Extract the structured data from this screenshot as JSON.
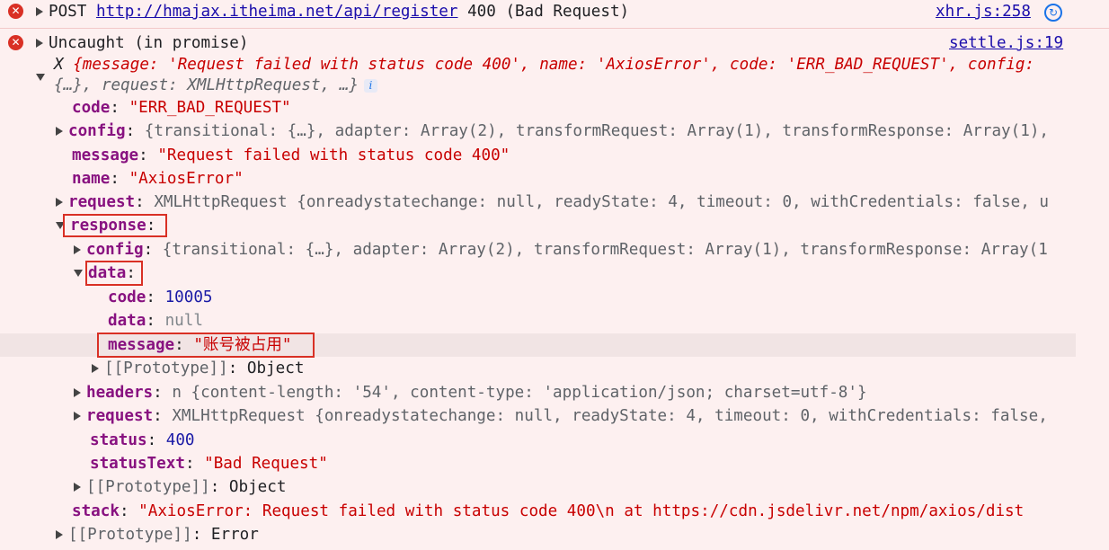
{
  "request_row": {
    "method": "POST",
    "url": "http://hmajax.itheima.net/api/register",
    "status": "400 (Bad Request)",
    "source": "xhr.js:258"
  },
  "error_row": {
    "title": "Uncaught (in promise)",
    "source": "settle.js:19"
  },
  "summary": {
    "prefix": "X ",
    "line1": "{message: 'Request failed with status code 400', name: 'AxiosError', code: 'ERR_BAD_REQUEST', config:",
    "line2": "{…}, request: XMLHttpRequest, …}",
    "info": "i"
  },
  "props": {
    "code": {
      "key": "code",
      "value": "\"ERR_BAD_REQUEST\""
    },
    "config": {
      "key": "config",
      "value": "{transitional: {…}, adapter: Array(2), transformRequest: Array(1), transformResponse: Array(1),"
    },
    "message": {
      "key": "message",
      "value": "\"Request failed with status code 400\""
    },
    "name": {
      "key": "name",
      "value": "\"AxiosError\""
    },
    "request": {
      "key": "request",
      "value": "XMLHttpRequest {onreadystatechange: null, readyState: 4, timeout: 0, withCredentials: false, u"
    },
    "response": {
      "key": "response"
    },
    "stack": {
      "key": "stack",
      "value": "\"AxiosError: Request failed with status code 400\\n    at https://cdn.jsdelivr.net/npm/axios/dist"
    },
    "proto": {
      "key": "[[Prototype]]",
      "value": "Error"
    }
  },
  "response": {
    "config": {
      "key": "config",
      "value": "{transitional: {…}, adapter: Array(2), transformRequest: Array(1), transformResponse: Array(1"
    },
    "data": {
      "key": "data"
    },
    "headers": {
      "key": "headers",
      "value": "n {content-length: '54', content-type: 'application/json; charset=utf-8'}"
    },
    "request": {
      "key": "request",
      "value": "XMLHttpRequest {onreadystatechange: null, readyState: 4, timeout: 0, withCredentials: false,"
    },
    "status": {
      "key": "status",
      "value": "400"
    },
    "statusText": {
      "key": "statusText",
      "value": "\"Bad Request\""
    },
    "proto": {
      "key": "[[Prototype]]",
      "value": "Object"
    }
  },
  "data": {
    "code": {
      "key": "code",
      "value": "10005"
    },
    "data": {
      "key": "data",
      "value": "null"
    },
    "message": {
      "key": "message",
      "value": "\"账号被占用\""
    },
    "proto": {
      "key": "[[Prototype]]",
      "value": "Object"
    }
  },
  "colors": {
    "error_bg": "#fdf0f0",
    "error_icon": "#d93025",
    "highlight_border": "#d93025",
    "key": "#881280",
    "string": "#c80000",
    "number": "#1a1aa6"
  }
}
